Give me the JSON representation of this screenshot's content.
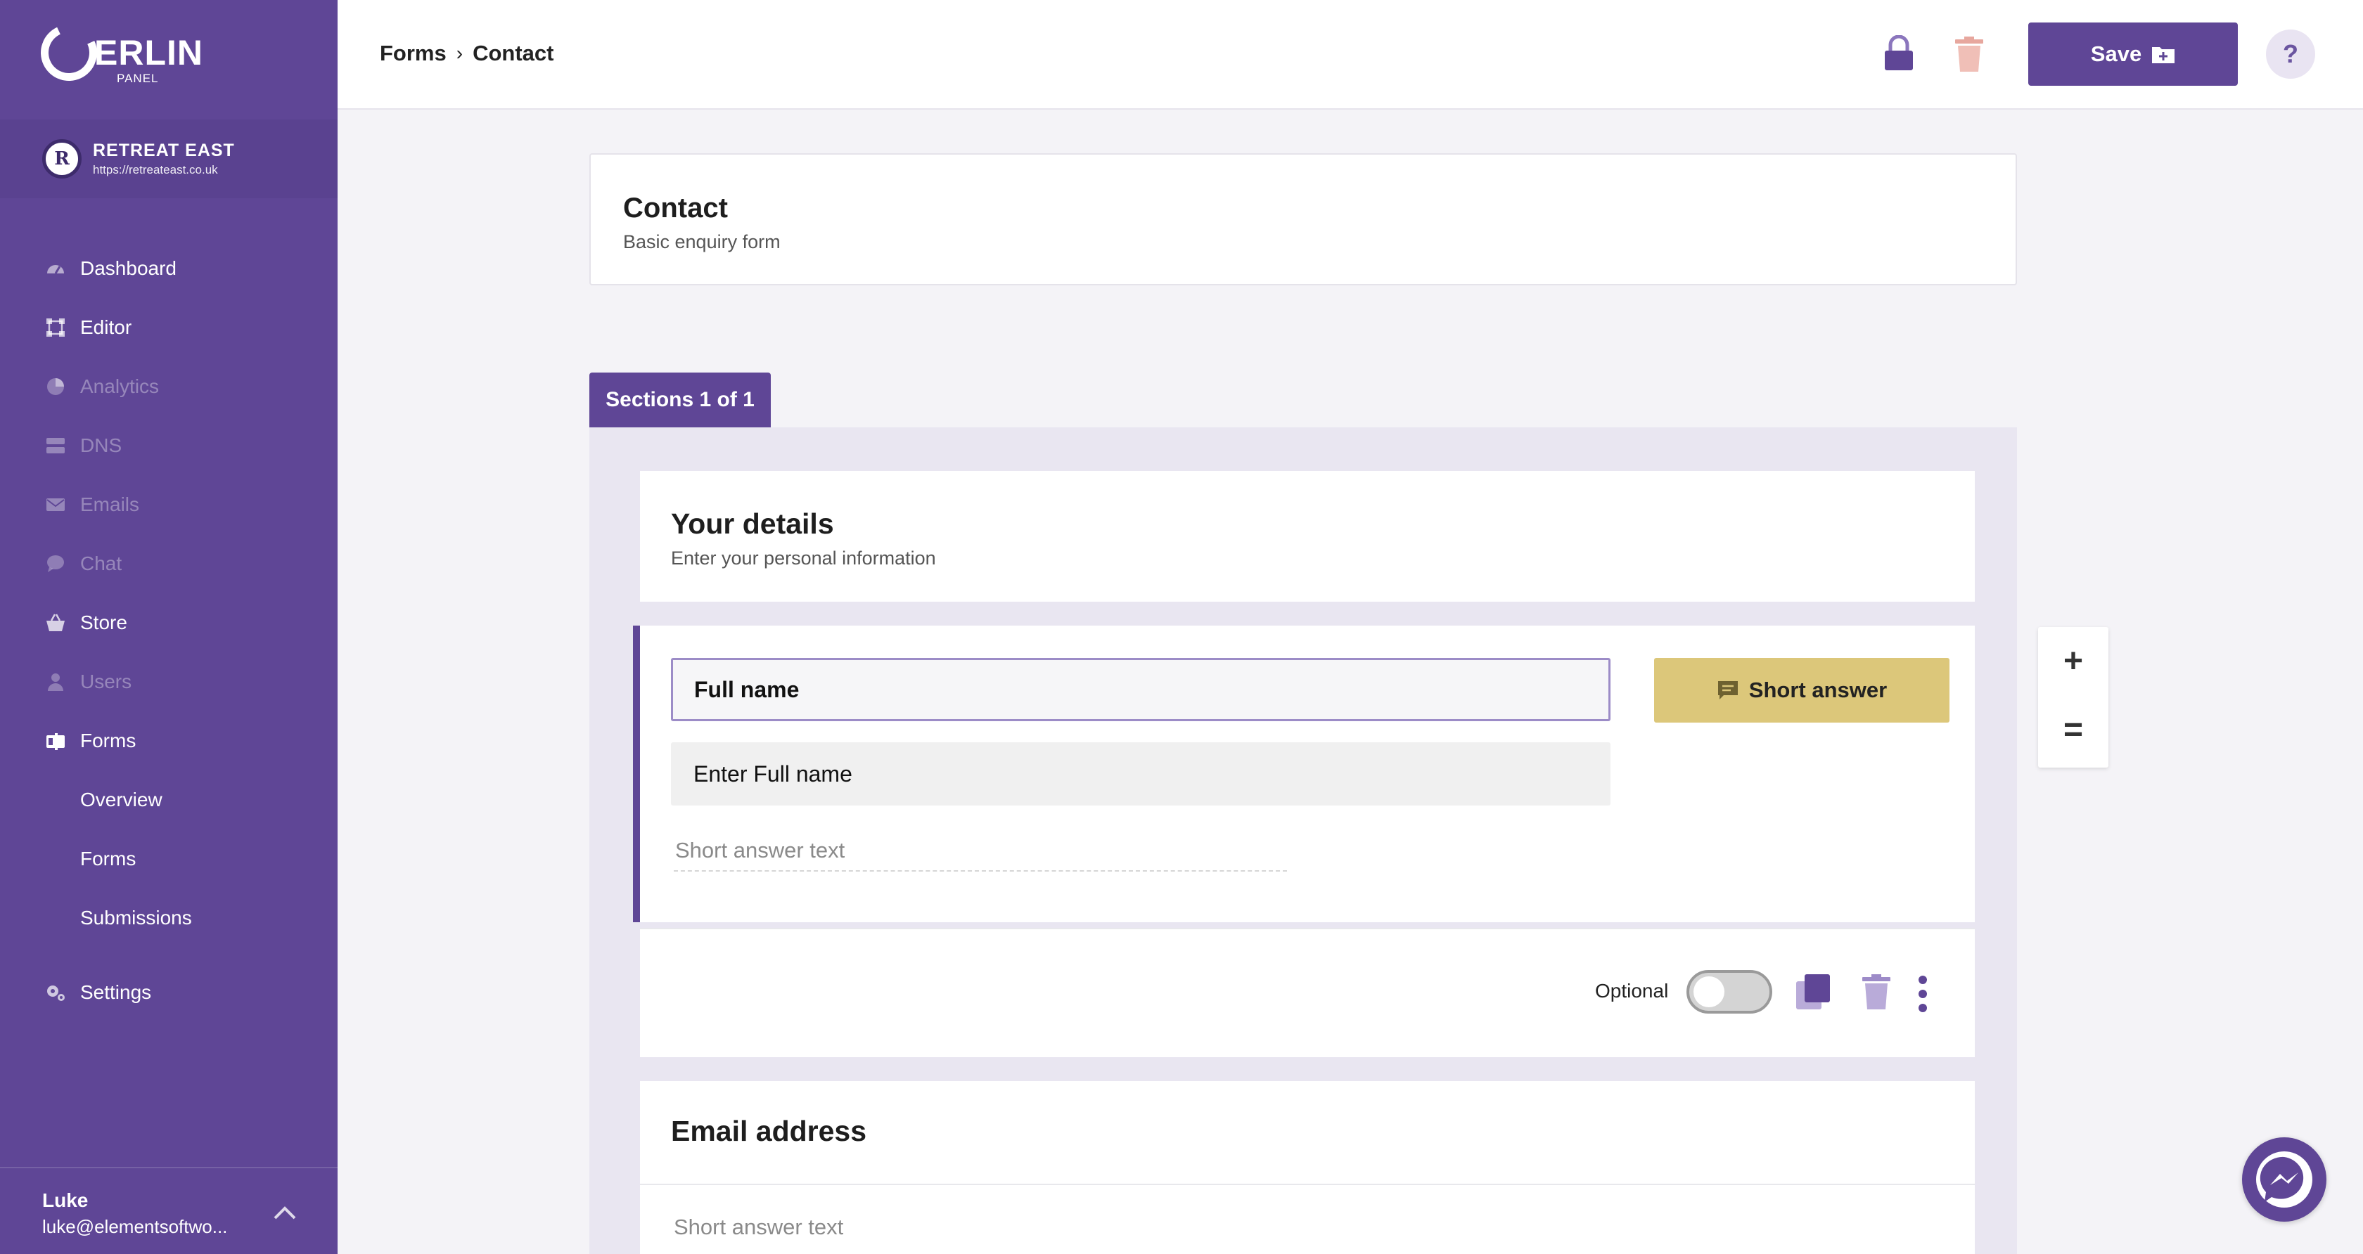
{
  "app": {
    "logo_text": "ERLIN",
    "logo_sub": "PANEL",
    "accent_color": "#5f4696"
  },
  "site": {
    "avatar_letter": "R",
    "name": "RETREAT EAST",
    "url": "https://retreateast.co.uk"
  },
  "nav": {
    "items": [
      {
        "label": "Dashboard",
        "icon": "gauge-icon",
        "enabled": true
      },
      {
        "label": "Editor",
        "icon": "frame-icon",
        "enabled": true
      },
      {
        "label": "Analytics",
        "icon": "pie-chart-icon",
        "enabled": false
      },
      {
        "label": "DNS",
        "icon": "server-icon",
        "enabled": false
      },
      {
        "label": "Emails",
        "icon": "envelope-icon",
        "enabled": false
      },
      {
        "label": "Chat",
        "icon": "chat-bubble-icon",
        "enabled": false
      },
      {
        "label": "Store",
        "icon": "basket-icon",
        "enabled": true
      },
      {
        "label": "Users",
        "icon": "user-icon",
        "enabled": false
      },
      {
        "label": "Forms",
        "icon": "forms-icon",
        "enabled": true
      }
    ],
    "forms_sub": [
      "Overview",
      "Forms",
      "Submissions"
    ],
    "settings": "Settings"
  },
  "user": {
    "name": "Luke",
    "email": "luke@elementsoftwo..."
  },
  "header": {
    "breadcrumb": [
      "Forms",
      "Contact"
    ],
    "save_label": "Save",
    "help_label": "?"
  },
  "form": {
    "title": "Contact",
    "description": "Basic enquiry form"
  },
  "sections": {
    "tab_label": "Sections 1 of 1",
    "title": "Your details",
    "description": "Enter your personal information"
  },
  "question1": {
    "title": "Full name",
    "placeholder_value": "Enter Full name",
    "answer_preview": "Short answer text",
    "type_label": "Short answer",
    "optional_label": "Optional",
    "optional_on": false
  },
  "question2": {
    "title": "Email address",
    "answer_preview": "Short answer text"
  },
  "zoom": {
    "plus": "+",
    "minus": "="
  }
}
